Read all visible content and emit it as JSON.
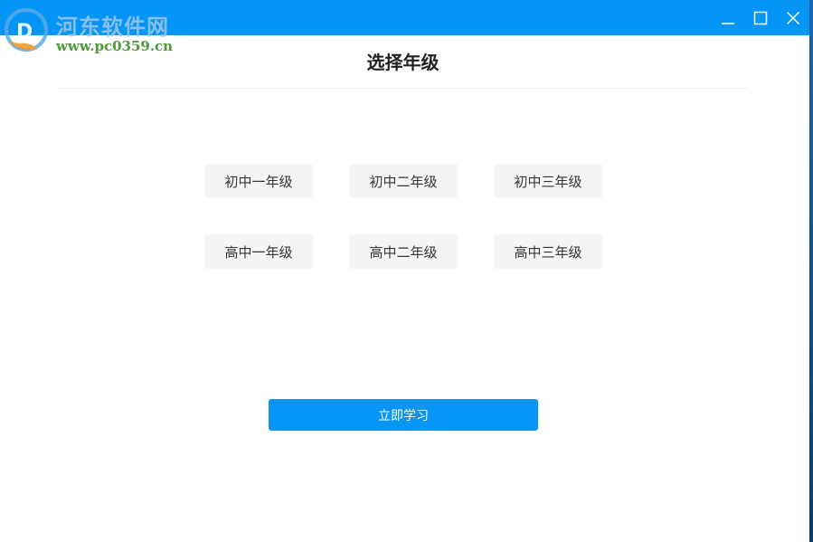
{
  "window": {
    "controls": {
      "minimize_icon": "minimize-icon",
      "maximize_icon": "maximize-icon",
      "close_icon": "close-icon"
    },
    "accent_color": "#0396f7"
  },
  "watermark": {
    "title": "河东软件网",
    "url": "www.pc0359.cn"
  },
  "page": {
    "title": "选择年级",
    "grades": [
      {
        "label": "初中一年级"
      },
      {
        "label": "初中二年级"
      },
      {
        "label": "初中三年级"
      },
      {
        "label": "高中一年级"
      },
      {
        "label": "高中二年级"
      },
      {
        "label": "高中三年级"
      }
    ],
    "start_label": "立即学习",
    "button_color": "#0796f5"
  }
}
